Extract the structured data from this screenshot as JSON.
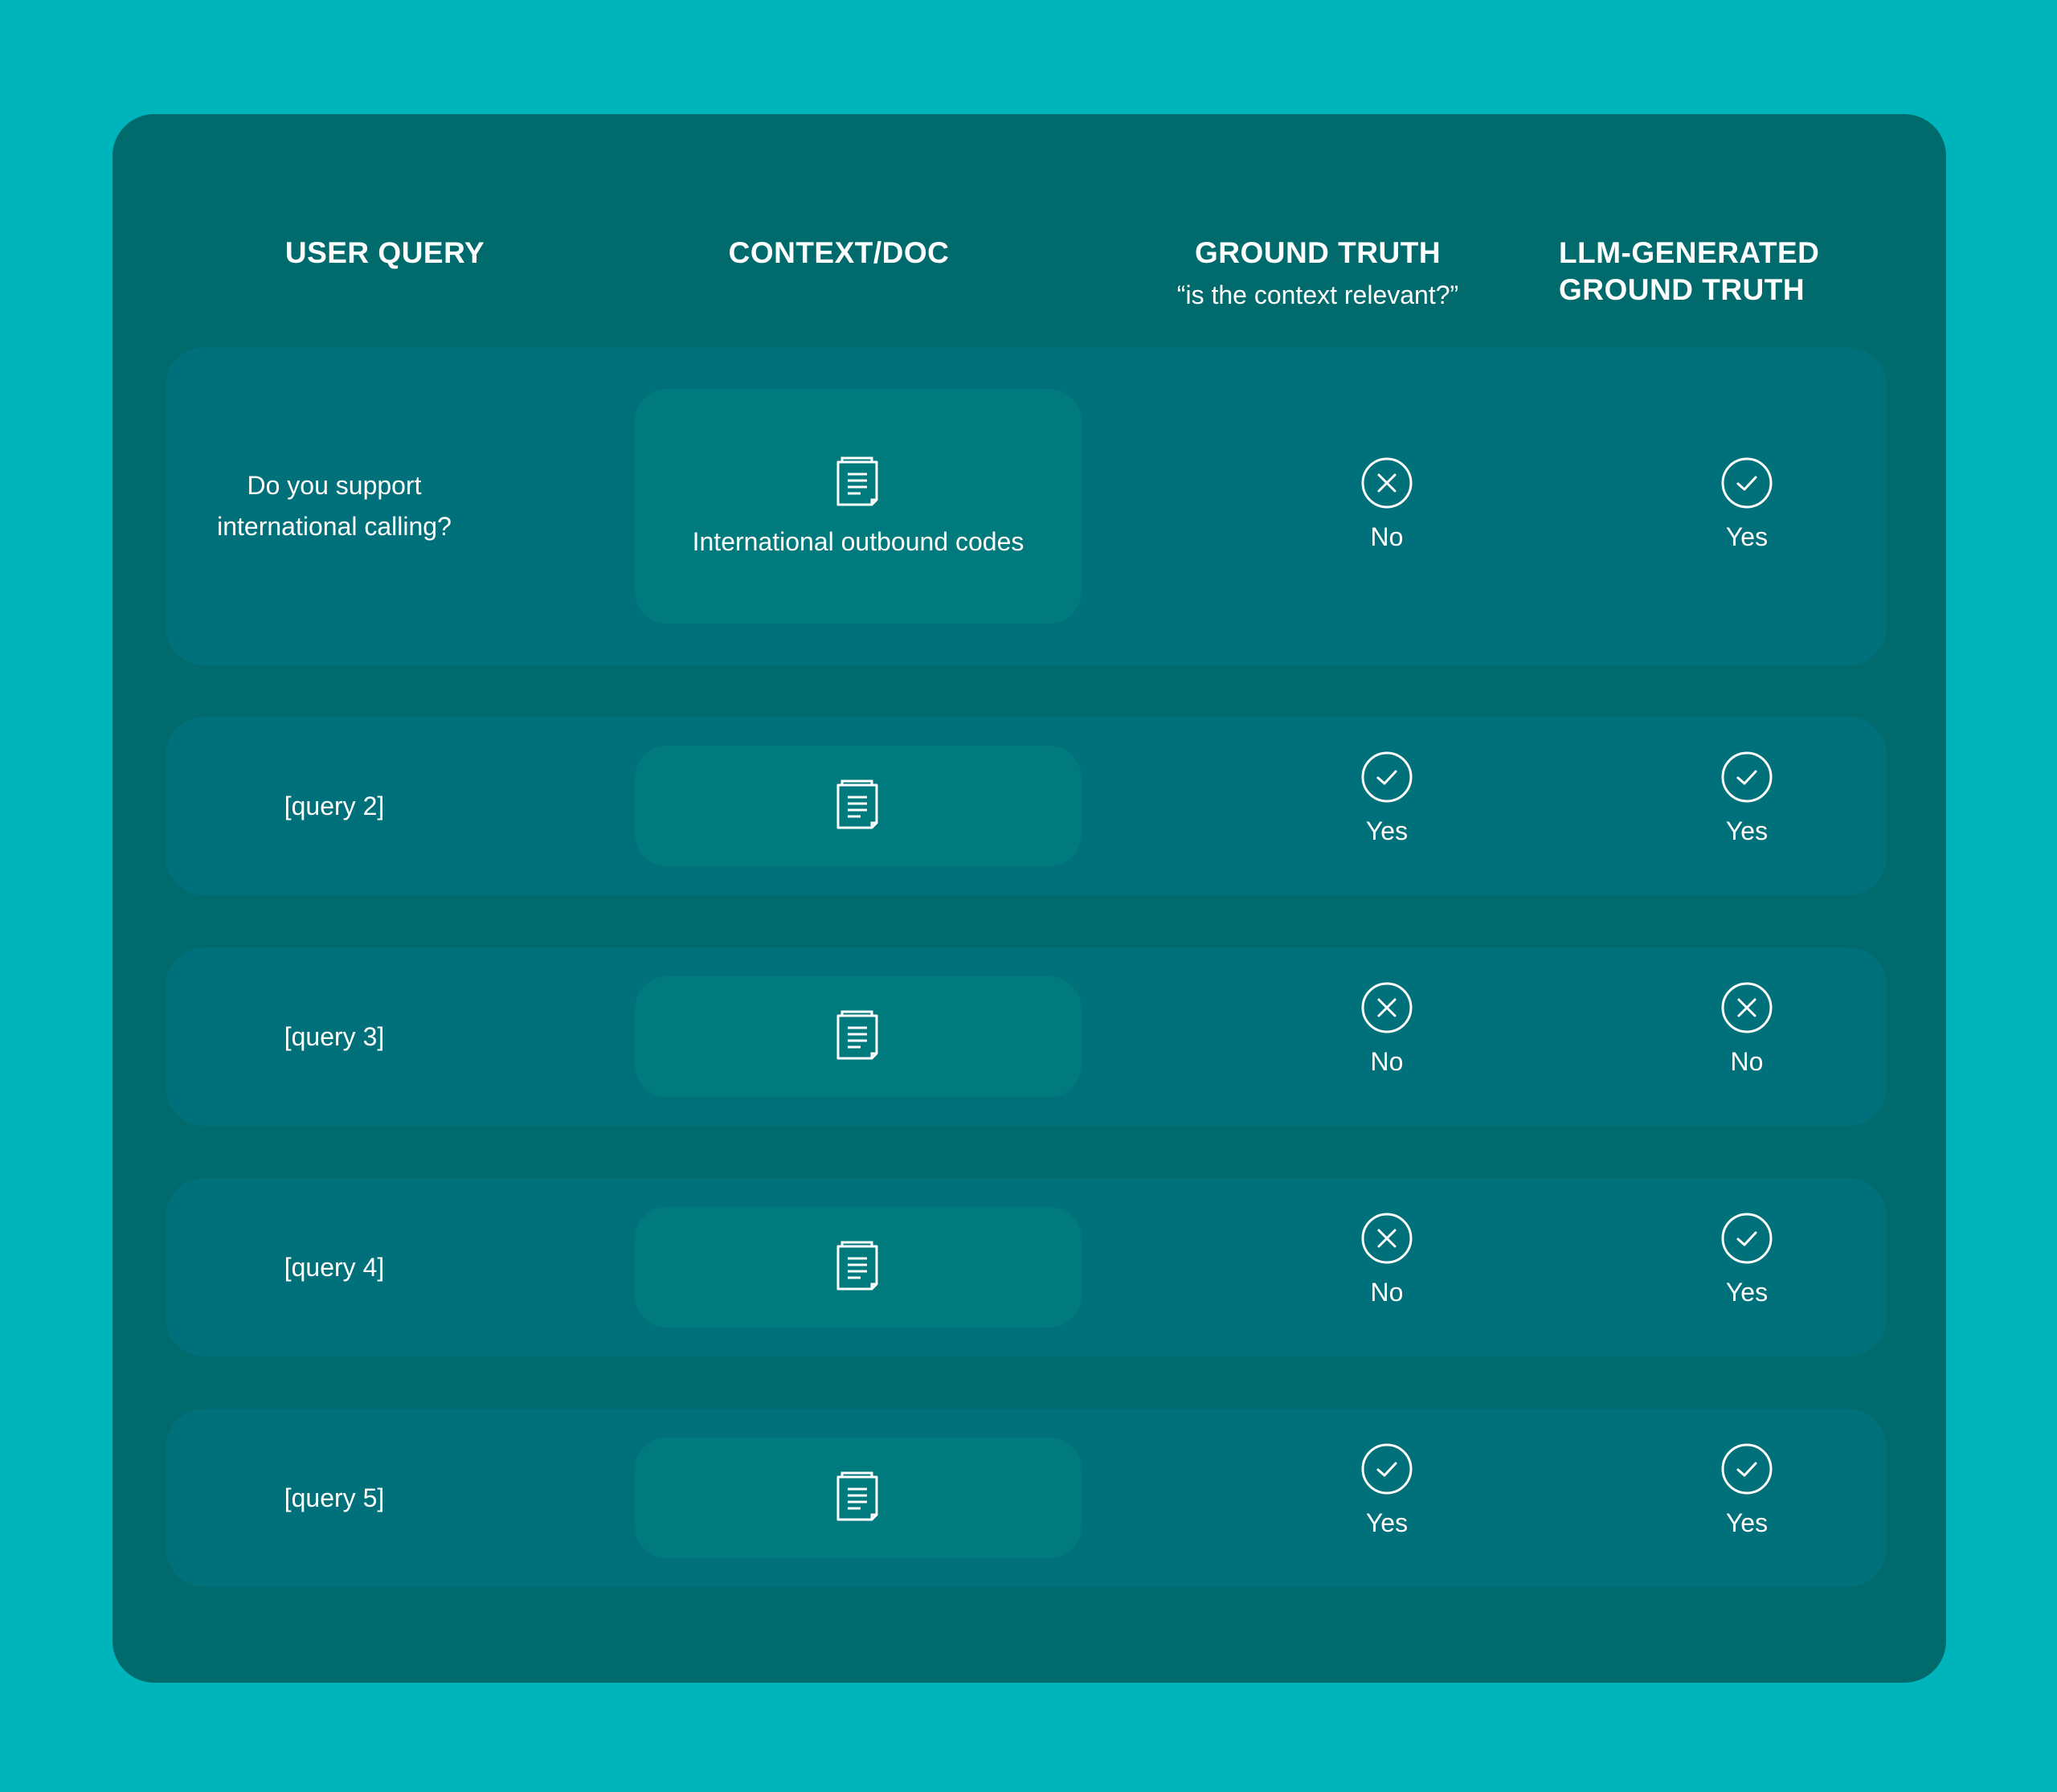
{
  "headers": {
    "user_query": "USER QUERY",
    "context_doc": "CONTEXT/DOC",
    "ground_truth": "GROUND TRUTH",
    "ground_truth_sub": "“is the context relevant?”",
    "llm_line1": "LLM-GENERATED",
    "llm_line2": "GROUND TRUTH"
  },
  "rows": [
    {
      "query_line1": "Do you support",
      "query_line2": "international calling?",
      "doc_label": "International outbound codes",
      "gt": "No",
      "gt_icon": "x-circle-icon",
      "llm": "Yes",
      "llm_icon": "check-circle-icon"
    },
    {
      "query_line1": "[query 2]",
      "query_line2": "",
      "doc_label": "",
      "gt": "Yes",
      "gt_icon": "check-circle-icon",
      "llm": "Yes",
      "llm_icon": "check-circle-icon"
    },
    {
      "query_line1": "[query 3]",
      "query_line2": "",
      "doc_label": "",
      "gt": "No",
      "gt_icon": "x-circle-icon",
      "llm": "No",
      "llm_icon": "x-circle-icon"
    },
    {
      "query_line1": "[query 4]",
      "query_line2": "",
      "doc_label": "",
      "gt": "No",
      "gt_icon": "x-circle-icon",
      "llm": "Yes",
      "llm_icon": "check-circle-icon"
    },
    {
      "query_line1": "[query 5]",
      "query_line2": "",
      "doc_label": "",
      "gt": "Yes",
      "gt_icon": "check-circle-icon",
      "llm": "Yes",
      "llm_icon": "check-circle-icon"
    }
  ],
  "colors": {
    "background": "#00b4bb",
    "panel": "#006a6d",
    "row": "#00717a",
    "doc_box": "#007a7d",
    "text": "#ffffff"
  }
}
